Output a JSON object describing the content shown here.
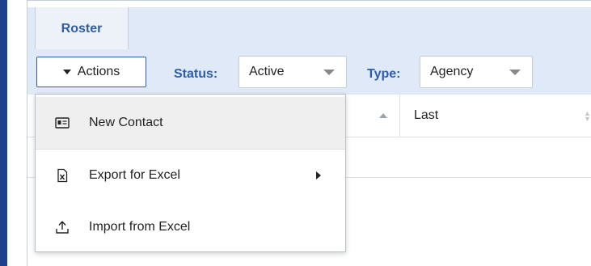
{
  "tab": {
    "label": "Roster"
  },
  "toolbar": {
    "actions_label": "Actions",
    "status_label": "Status:",
    "status_value": "Active",
    "type_label": "Type:",
    "type_value": "Agency"
  },
  "grid": {
    "columns": [
      "Last"
    ]
  },
  "menu": {
    "items": [
      {
        "label": "New Contact",
        "icon": "contact-card-icon"
      },
      {
        "label": "Export for Excel",
        "icon": "excel-file-icon"
      },
      {
        "label": "Import from Excel",
        "icon": "upload-icon"
      }
    ]
  },
  "colors": {
    "accent": "#2f5ea8",
    "toolbar_bg": "#dfe9f7",
    "left_bar": "#1f3f8f"
  }
}
